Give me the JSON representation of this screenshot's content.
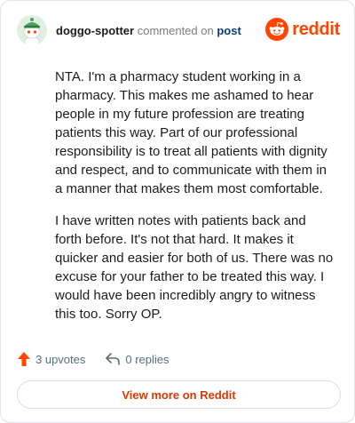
{
  "header": {
    "username": "doggo-spotter",
    "commented_on": "commented on",
    "post_link": "post",
    "brand": "reddit"
  },
  "comment": {
    "paragraphs": [
      "NTA. I'm a pharmacy student working in a pharmacy. This makes me ashamed to hear people in my future profession are treating patients this way. Part of our professional responsibility is to treat all patients with dignity and respect, and to communicate with them in a manner that makes them most comfortable.",
      "I have written notes with patients back and forth before. It's not that hard. It makes it quicker and easier for both of us. There was no excuse for your father to be treated this way. I would have been incredibly angry to witness this too. Sorry OP."
    ]
  },
  "actions": {
    "upvotes": "3 upvotes",
    "replies": "0 replies"
  },
  "footer": {
    "view_more": "View more on Reddit"
  },
  "colors": {
    "brand": "#ff4500",
    "link": "#0a3c7d",
    "view_more_text": "#d93a00",
    "muted": "#576f76"
  },
  "icons": {
    "avatar": "snoo-avatar-green-hat",
    "logo": "reddit-logo-icon",
    "upvote": "upvote-arrow-icon",
    "reply": "reply-arrow-icon"
  }
}
